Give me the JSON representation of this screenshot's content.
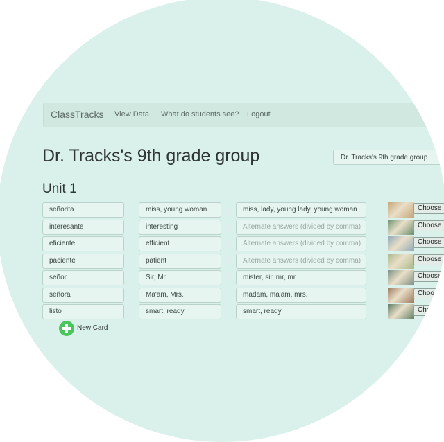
{
  "nav": {
    "brand": "ClassTracks",
    "links": [
      "View Data",
      "What do students see?",
      "Logout"
    ]
  },
  "page_title": "Dr. Tracks's 9th grade group",
  "group_selector": "Dr. Tracks's 9th grade group",
  "unit_title": "Unit 1",
  "alternate_placeholder": "Alternate answers (divided by comma)",
  "cards": [
    {
      "term": "señorita",
      "translation": "miss, young woman",
      "alternates": "miss, lady, young lady, young woman",
      "choose_label": "Choose"
    },
    {
      "term": "interesante",
      "translation": "interesting",
      "alternates": "",
      "choose_label": "Choose"
    },
    {
      "term": "eficiente",
      "translation": "efficient",
      "alternates": "",
      "choose_label": "Choose"
    },
    {
      "term": "paciente",
      "translation": "patient",
      "alternates": "",
      "choose_label": "Choose"
    },
    {
      "term": "señor",
      "translation": "Sir, Mr.",
      "alternates": "mister, sir, mr, mr.",
      "choose_label": "Choose"
    },
    {
      "term": "señora",
      "translation": "Ma'am, Mrs.",
      "alternates": "madam, ma'am, mrs.",
      "choose_label": "Choose"
    },
    {
      "term": "listo",
      "translation": "smart, ready",
      "alternates": "smart, ready",
      "choose_label": "Choose"
    }
  ],
  "new_card_label": "New Card",
  "thumbnail_colors": [
    "#c6a57a",
    "#6a8f6f",
    "#8ea9b6",
    "#a8b88a",
    "#7d8f82",
    "#9c7a5e",
    "#5f7d63"
  ],
  "accent_color": "#4cc45e"
}
